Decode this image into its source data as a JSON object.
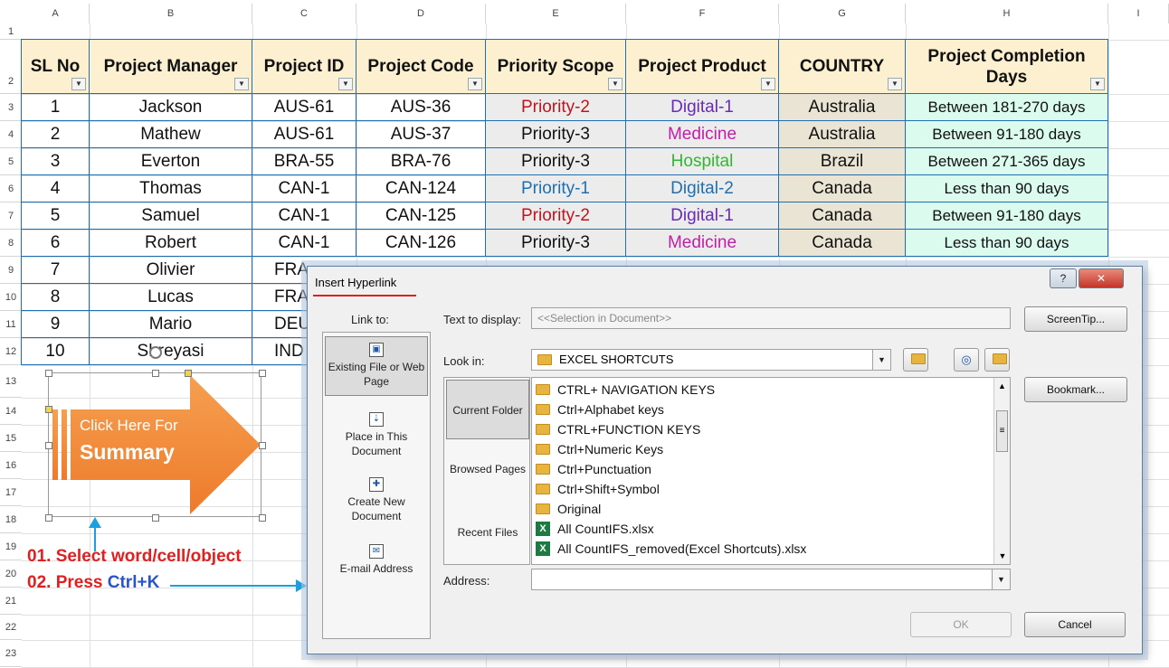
{
  "columns": [
    "A",
    "B",
    "C",
    "D",
    "E",
    "F",
    "G",
    "H",
    "I"
  ],
  "rows": [
    "1",
    "2",
    "3",
    "4",
    "5",
    "6",
    "7",
    "8",
    "9",
    "10",
    "11",
    "12",
    "13",
    "14",
    "15",
    "16",
    "17",
    "18",
    "19",
    "20",
    "21",
    "22",
    "23"
  ],
  "table": {
    "headers": [
      "SL No",
      "Project Manager",
      "Project ID",
      "Project Code",
      "Priority Scope",
      "Project Product",
      "COUNTRY",
      "Project Completion Days"
    ],
    "filter_icon": "dropdown-filter-icon",
    "rows": [
      [
        "1",
        "Jackson",
        "AUS-61",
        "AUS-36",
        "Priority-2",
        "Digital-1",
        "Australia",
        "Between 181-270 days"
      ],
      [
        "2",
        "Mathew",
        "AUS-61",
        "AUS-37",
        "Priority-3",
        "Medicine",
        "Australia",
        "Between 91-180 days"
      ],
      [
        "3",
        "Everton",
        "BRA-55",
        "BRA-76",
        "Priority-3",
        "Hospital",
        "Brazil",
        "Between 271-365 days"
      ],
      [
        "4",
        "Thomas",
        "CAN-1",
        "CAN-124",
        "Priority-1",
        "Digital-2",
        "Canada",
        "Less than 90 days"
      ],
      [
        "5",
        "Samuel",
        "CAN-1",
        "CAN-125",
        "Priority-2",
        "Digital-1",
        "Canada",
        "Between 91-180 days"
      ],
      [
        "6",
        "Robert",
        "CAN-1",
        "CAN-126",
        "Priority-3",
        "Medicine",
        "Canada",
        "Less than 90 days"
      ],
      [
        "7",
        "Olivier",
        "FRA",
        "",
        "",
        "",
        "",
        ""
      ],
      [
        "8",
        "Lucas",
        "FRA",
        "",
        "",
        "",
        "",
        ""
      ],
      [
        "9",
        "Mario",
        "DEU",
        "",
        "",
        "",
        "",
        ""
      ],
      [
        "10",
        "Shreyasi",
        "IND",
        "",
        "",
        "",
        "",
        ""
      ]
    ],
    "colors": {
      "header_bg": "#fdf0d0",
      "priority_bg": "#ececec",
      "product_bg": "#ececec",
      "country_bg": "#e9e4d3",
      "days_bg": "#dcfbef",
      "border": "#1f6fb0",
      "priority-1": "#1f6fb0",
      "priority-2": "#c0141d",
      "priority-3": "#111111",
      "Digital-1": "#6a2ab8",
      "Digital-2": "#1f6fb0",
      "Medicine": "#c01fa6",
      "Hospital": "#2fb82f"
    }
  },
  "shape": {
    "line1": "Click Here For",
    "line2": "Summary",
    "fill": "#ee7a2c"
  },
  "notes": {
    "line1": "01. Select word/cell/object",
    "line2_prefix": "02. Press ",
    "line2_key": "Ctrl+K"
  },
  "dialog": {
    "title": "Insert Hyperlink",
    "help_label": "?",
    "close_label": "✕",
    "link_to_label": "Link to:",
    "link_options": [
      {
        "label": "Existing File or Web Page",
        "icon": "existing-file-icon"
      },
      {
        "label": "Place in This Document",
        "icon": "place-in-document-icon"
      },
      {
        "label": "Create New Document",
        "icon": "new-document-icon"
      },
      {
        "label": "E-mail Address",
        "icon": "email-icon"
      }
    ],
    "text_to_display_label": "Text to display:",
    "text_to_display_value": "<<Selection in Document>>",
    "screentip_label": "ScreenTip...",
    "look_in_label": "Look in:",
    "look_in_value": "EXCEL SHORTCUTS",
    "nav_options": [
      "Current Folder",
      "Browsed Pages",
      "Recent Files"
    ],
    "files": [
      {
        "name": "CTRL+ NAVIGATION KEYS",
        "type": "folder"
      },
      {
        "name": "Ctrl+Alphabet keys",
        "type": "folder"
      },
      {
        "name": "CTRL+FUNCTION KEYS",
        "type": "folder"
      },
      {
        "name": "Ctrl+Numeric Keys",
        "type": "folder"
      },
      {
        "name": "Ctrl+Punctuation",
        "type": "folder"
      },
      {
        "name": "Ctrl+Shift+Symbol",
        "type": "folder"
      },
      {
        "name": "Original",
        "type": "folder"
      },
      {
        "name": "All CountIFS.xlsx",
        "type": "xlsx"
      },
      {
        "name": "All CountIFS_removed(Excel Shortcuts).xlsx",
        "type": "xlsx"
      }
    ],
    "bookmark_label": "Bookmark...",
    "address_label": "Address:",
    "address_value": "",
    "ok_label": "OK",
    "cancel_label": "Cancel",
    "up_folder_icon": "up-folder-icon",
    "browse_web_icon": "browse-web-icon",
    "browse_file_icon": "browse-file-icon"
  }
}
